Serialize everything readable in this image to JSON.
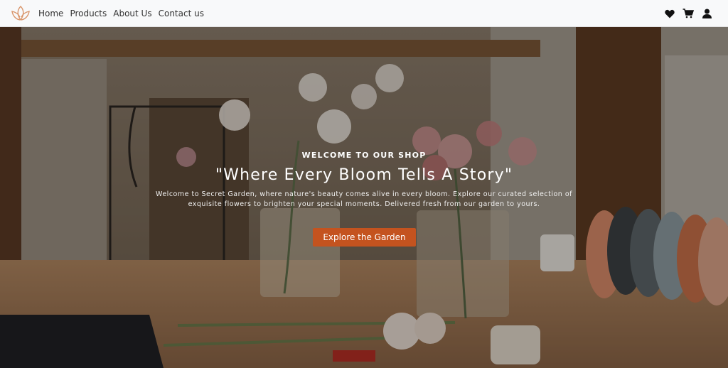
{
  "nav": {
    "logo_icon": "lotus-logo-icon",
    "links": [
      {
        "label": "Home"
      },
      {
        "label": "Products"
      },
      {
        "label": "About Us"
      },
      {
        "label": "Contact us"
      }
    ],
    "icons": [
      "heart-icon",
      "cart-icon",
      "user-icon"
    ]
  },
  "hero": {
    "eyebrow": "WELCOME TO OUR SHOP",
    "headline": "\"Where Every Bloom Tells A Story\"",
    "description": "Welcome to Secret Garden, where nature's beauty comes alive in every bloom. Explore our curated selection of exquisite flowers to brighten your special moments. Delivered fresh from our garden to yours.",
    "cta_label": "Explore the Garden"
  },
  "colors": {
    "accent": "#c4531f",
    "logo": "#d9956a",
    "navbar_bg": "#f8f9fa"
  }
}
